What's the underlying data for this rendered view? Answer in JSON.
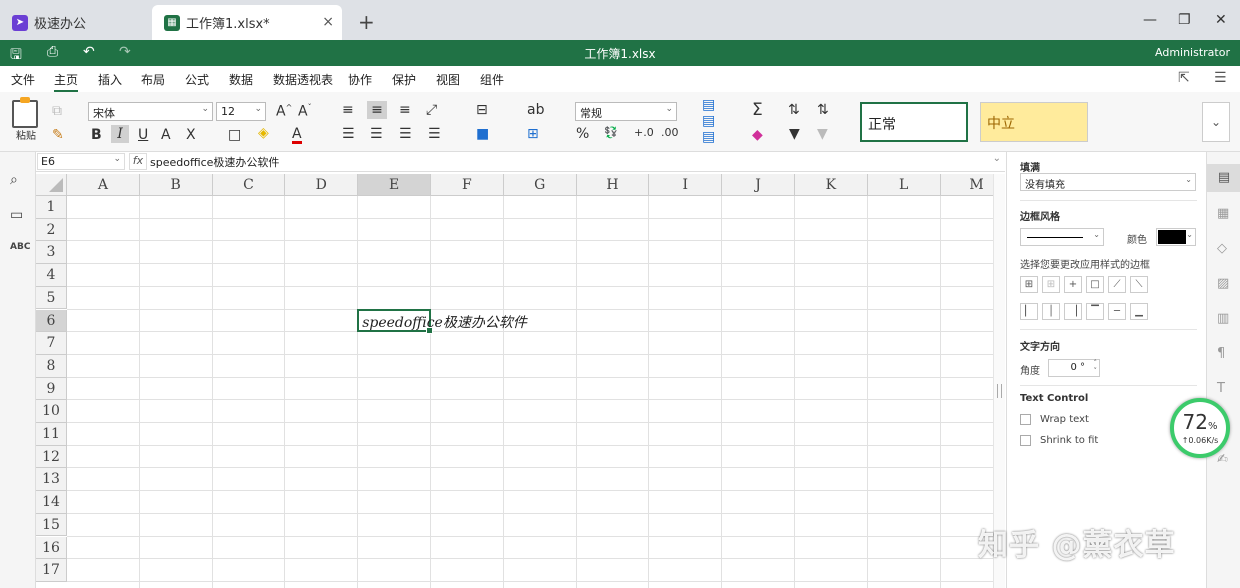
{
  "tabs": [
    {
      "label": "极速办公",
      "icon": "rocket-icon"
    },
    {
      "label": "工作簿1.xlsx*",
      "icon": "spreadsheet-icon",
      "close": "×"
    }
  ],
  "new_tab": "+",
  "window_controls": {
    "minimize": "—",
    "restore": "❐",
    "close": "✕"
  },
  "titlebar": {
    "title": "工作簿1.xlsx",
    "user": "Administrator",
    "save_icon": "🖫",
    "print_icon": "⎙",
    "undo_icon": "↶",
    "redo_icon": "↷"
  },
  "menu": {
    "items": [
      "文件",
      "主页",
      "插入",
      "布局",
      "公式",
      "数据",
      "数据透视表",
      "协作",
      "保护",
      "视图",
      "组件"
    ],
    "active": "主页"
  },
  "ribbon": {
    "paste_label": "粘贴",
    "font_name": "宋体",
    "font_size": "12",
    "number_format": "常规",
    "style_normal": "正常",
    "style_neutral": "中立",
    "collapse_icon": "⌄"
  },
  "formula_bar": {
    "cell_ref": "E6",
    "fx_label": "fx",
    "content": "speedoffice极速办公软件"
  },
  "grid": {
    "columns": [
      "A",
      "B",
      "C",
      "D",
      "E",
      "F",
      "G",
      "H",
      "I",
      "J",
      "K",
      "L",
      "M"
    ],
    "rows": [
      "1",
      "2",
      "3",
      "4",
      "5",
      "6",
      "7",
      "8",
      "9",
      "10",
      "11",
      "12",
      "13",
      "14",
      "15",
      "16",
      "17"
    ],
    "selected_column": "E",
    "selected_row": "6",
    "cell_E6": "speedoffice极速办公软件"
  },
  "panel": {
    "fill_title": "填满",
    "fill_value": "没有填充",
    "border_title": "边框风格",
    "color_label": "颜色",
    "border_color": "#000000",
    "border_hint": "选择您要更改应用样式的边框",
    "text_dir_title": "文字方向",
    "angle_label": "角度",
    "angle_value": "0 °",
    "text_control_title": "Text Control",
    "wrap_label": "Wrap text",
    "shrink_label": "Shrink to fit"
  },
  "speed_widget": {
    "percent": "72",
    "unit": "%",
    "rate": "↑0.06K/s"
  },
  "watermark": "知乎 @薰衣草",
  "colors": {
    "accent": "#207245",
    "neutral_bg": "#ffeb9c",
    "speed_ring": "#3ccb6b"
  }
}
